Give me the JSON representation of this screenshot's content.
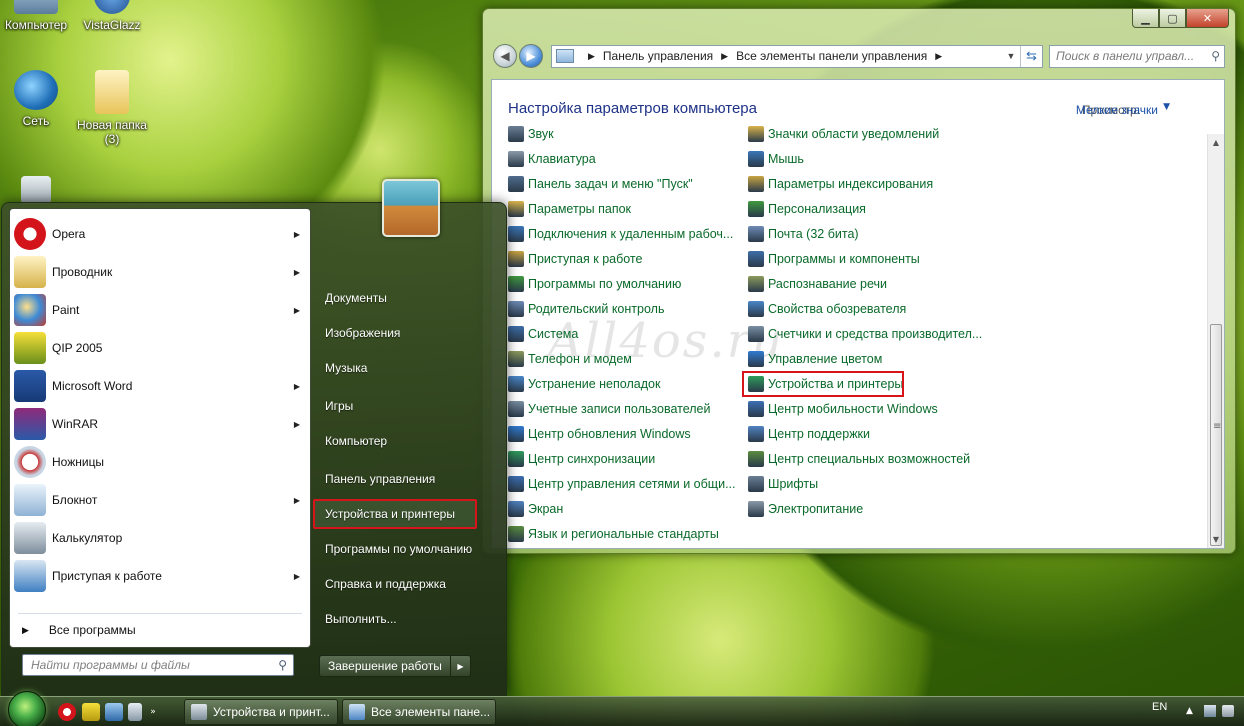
{
  "desktop": {
    "icons": [
      {
        "label": "Компьютер",
        "icon": "computer-icon"
      },
      {
        "label": "VistaGlazz",
        "icon": "vistaglazz-icon"
      },
      {
        "label": "Сеть",
        "icon": "network-icon"
      },
      {
        "label": "Новая папка",
        "sublabel": "(3)",
        "icon": "folder-icon"
      },
      {
        "label": "",
        "icon": "recycle-bin-icon"
      }
    ]
  },
  "control_panel": {
    "address": {
      "crumbs": [
        "Панель управления",
        "Все элементы панели управления"
      ]
    },
    "search_placeholder": "Поиск в панели управл...",
    "title": "Настройка параметров компьютера",
    "view_label": "Просмотр:",
    "view_value": "Мелкие значки",
    "watermark": "All4os.ru",
    "col1": [
      "Звук",
      "Клавиатура",
      "Панель задач и меню \"Пуск\"",
      "Параметры папок",
      "Подключения к удаленным рабоч...",
      "Приступая к работе",
      "Программы по умолчанию",
      "Родительский контроль",
      "Система",
      "Телефон и модем",
      "Устранение неполадок",
      "Учетные записи пользователей",
      "Центр обновления Windows",
      "Центр синхронизации",
      "Центр управления сетями и общи...",
      "Экран",
      "Язык и региональные стандарты"
    ],
    "col2": [
      "Значки области уведомлений",
      "Мышь",
      "Параметры индексирования",
      "Персонализация",
      "Почта (32 бита)",
      "Программы и компоненты",
      "Распознавание речи",
      "Свойства обозревателя",
      "Счетчики и средства производител...",
      "Управление цветом",
      "Устройства и принтеры",
      "Центр мобильности Windows",
      "Центр поддержки",
      "Центр специальных возможностей",
      "Шрифты",
      "Электропитание"
    ],
    "highlighted": "Устройства и принтеры"
  },
  "start_menu": {
    "programs": [
      {
        "label": "Opera",
        "arrow": true
      },
      {
        "label": "Проводник",
        "arrow": true
      },
      {
        "label": "Paint",
        "arrow": true
      },
      {
        "label": "QIP 2005",
        "arrow": false
      },
      {
        "label": "Microsoft Word",
        "arrow": true
      },
      {
        "label": "WinRAR",
        "arrow": true
      },
      {
        "label": "Ножницы",
        "arrow": false
      },
      {
        "label": "Блокнот",
        "arrow": true
      },
      {
        "label": "Калькулятор",
        "arrow": false
      },
      {
        "label": "Приступая к работе",
        "arrow": true
      }
    ],
    "all_programs": "Все программы",
    "search_placeholder": "Найти программы и файлы",
    "right": [
      "Документы",
      "Изображения",
      "Музыка",
      "Игры",
      "Компьютер",
      "Панель управления",
      "Устройства и принтеры",
      "Программы по умолчанию",
      "Справка и поддержка",
      "Выполнить..."
    ],
    "shutdown": "Завершение работы"
  },
  "taskbar": {
    "tasks": [
      "Устройства и принт...",
      "Все элементы пане..."
    ],
    "lang": "EN"
  },
  "colors": {
    "link_green": "#0a6a2a",
    "title_blue": "#1e3287",
    "highlight_red": "#d7141a"
  }
}
